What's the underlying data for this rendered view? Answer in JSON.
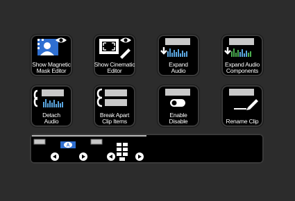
{
  "tiles": [
    {
      "id": "show-magnetic-mask-editor",
      "label": "Show Magnetic\nMask Editor",
      "icon": "magnetic-mask-editor-icon"
    },
    {
      "id": "show-cinematic-editor",
      "label": "Show Cinematic\nEditor",
      "icon": "cinematic-editor-icon"
    },
    {
      "id": "expand-audio",
      "label": "Expand\nAudio",
      "icon": "expand-audio-icon"
    },
    {
      "id": "expand-audio-components",
      "label": "Expand Audio\nComponents",
      "icon": "expand-audio-components-icon"
    },
    {
      "id": "detach-audio",
      "label": "Detach\nAudio",
      "icon": "detach-audio-icon"
    },
    {
      "id": "break-apart-clip-items",
      "label": "Break Apart\nClip Items",
      "icon": "break-apart-icon"
    },
    {
      "id": "enable-disable",
      "label": "Enable\nDisable",
      "icon": "toggle-icon"
    },
    {
      "id": "rename-clip",
      "label": "Rename Clip",
      "icon": "rename-pencil-icon"
    }
  ],
  "colors": {
    "background": "#2c2c2c",
    "tile": "#000000",
    "accent_blue": "#3a7bd5",
    "audio_blue": "#5aa6e0",
    "audio_green": "#4caf50",
    "clip_gray": "#c8c8c8"
  },
  "navigator": {
    "badge_letter": "A",
    "icons": [
      "prev-left-icon",
      "next-right-icon",
      "prev-page-icon",
      "grid-icon",
      "next-page-icon"
    ]
  }
}
